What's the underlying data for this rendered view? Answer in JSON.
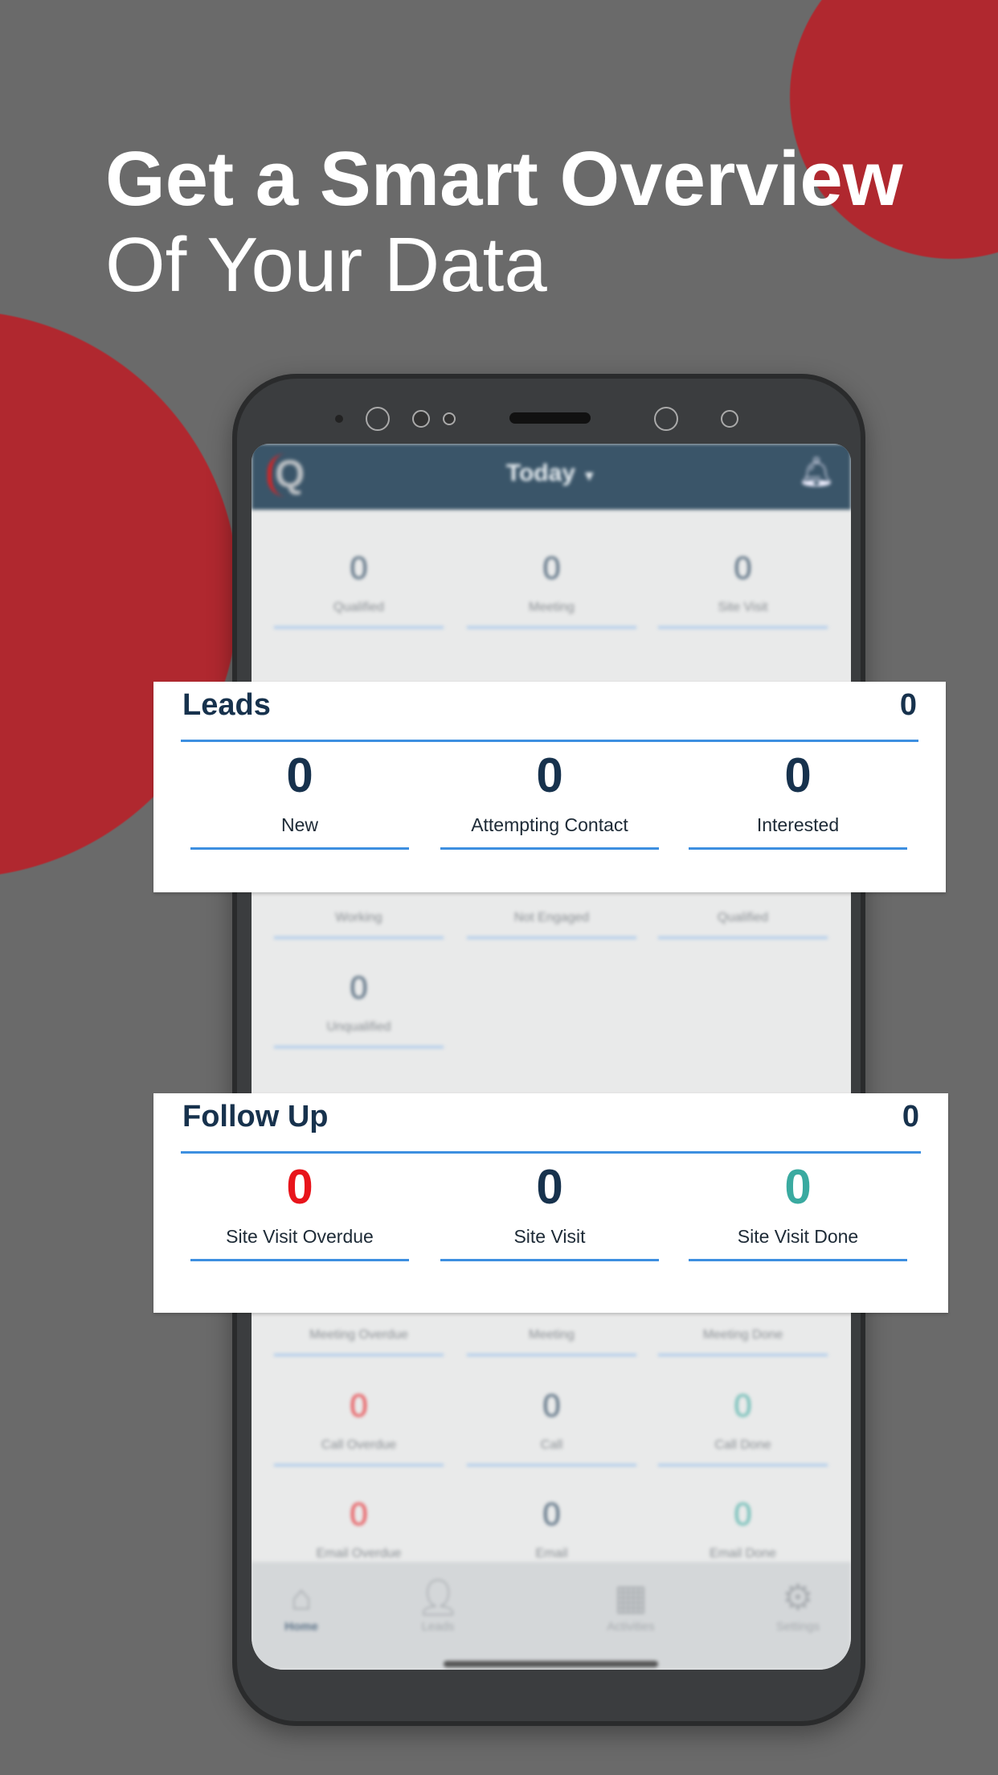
{
  "headline": {
    "line1": "Get a Smart Overview",
    "line2": "Of Your Data"
  },
  "colors": {
    "background": "#6a6a6a",
    "accent_red": "#b0282f",
    "app_bar": "#3a5569",
    "overdue": "#e8141b",
    "neutral": "#17324d",
    "done": "#3aaaa0",
    "underline": "#3d8fe0"
  },
  "app": {
    "period": "Today",
    "period_icon": "caret-down-icon",
    "logo": "Q",
    "bell_icon": "bell-icon",
    "background_rows": [
      [
        {
          "value": "0",
          "label": "Qualified"
        },
        {
          "value": "0",
          "label": "Meeting"
        },
        {
          "value": "0",
          "label": "Site Visit"
        }
      ],
      [
        {
          "label": "Working"
        },
        {
          "label": "Not Engaged"
        },
        {
          "label": "Qualified"
        }
      ],
      [
        {
          "value": "0",
          "label": "Unqualified"
        }
      ],
      [
        {
          "label": "Meeting Overdue"
        },
        {
          "label": "Meeting"
        },
        {
          "label": "Meeting Done"
        }
      ],
      [
        {
          "value": "0",
          "label": "Call Overdue",
          "tone": "overdue"
        },
        {
          "value": "0",
          "label": "Call"
        },
        {
          "value": "0",
          "label": "Call Done",
          "tone": "done"
        }
      ],
      [
        {
          "value": "0",
          "label": "Email Overdue",
          "tone": "overdue"
        },
        {
          "value": "0",
          "label": "Email"
        },
        {
          "value": "0",
          "label": "Email Done",
          "tone": "done"
        }
      ]
    ],
    "nav": [
      {
        "label": "Home",
        "icon": "home-icon",
        "active": true
      },
      {
        "label": "Leads",
        "icon": "person-icon"
      },
      {
        "label": "Activities",
        "icon": "calendar-icon"
      },
      {
        "label": "Settings",
        "icon": "gear-icon"
      }
    ]
  },
  "leads": {
    "title": "Leads",
    "count": "0",
    "items": [
      {
        "value": "0",
        "label": "New"
      },
      {
        "value": "0",
        "label": "Attempting Contact"
      },
      {
        "value": "0",
        "label": "Interested"
      }
    ]
  },
  "follow_up": {
    "title": "Follow Up",
    "count": "0",
    "items": [
      {
        "value": "0",
        "label": "Site Visit Overdue",
        "tone": "overdue"
      },
      {
        "value": "0",
        "label": "Site Visit"
      },
      {
        "value": "0",
        "label": "Site Visit Done",
        "tone": "done"
      }
    ]
  }
}
